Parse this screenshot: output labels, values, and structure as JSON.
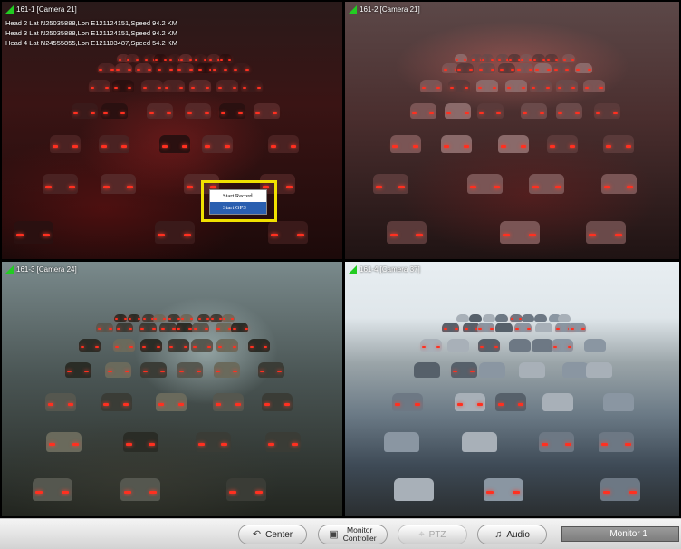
{
  "cameras": [
    {
      "label": "161-1 [Camera 21]"
    },
    {
      "label": "161-2 [Camera 21]"
    },
    {
      "label": "161-3 [Camera 24]"
    },
    {
      "label": "161-4 [Camera 37]"
    }
  ],
  "gps": {
    "lines": [
      "Head 2 Lat N25035888,Lon E121124151,Speed 94.2 KM",
      "Head 3 Lat N25035888,Lon E121124151,Speed 94.2 KM",
      "Head 4 Lat N24555855,Lon E121103487,Speed 54.2 KM"
    ]
  },
  "context_menu": {
    "items": [
      "Start Record",
      "Start GPS"
    ],
    "selected_index": 1
  },
  "toolbar": {
    "center_label": "Center",
    "monitor_controller_line1": "Monitor",
    "monitor_controller_line2": "Controller",
    "ptz_label": "PTZ",
    "audio_label": "Audio",
    "monitor_display": "Monitor 1"
  },
  "icons": {
    "center": "center-arrow-icon",
    "monitor_controller": "monitor-icon",
    "ptz": "ptz-camera-icon",
    "audio": "speaker-icon",
    "camera_status": "green-triangle-icon"
  },
  "colors": {
    "highlight": "#f0e000",
    "menu_selected": "#2a5fb0",
    "status_ok": "#22cc22"
  }
}
